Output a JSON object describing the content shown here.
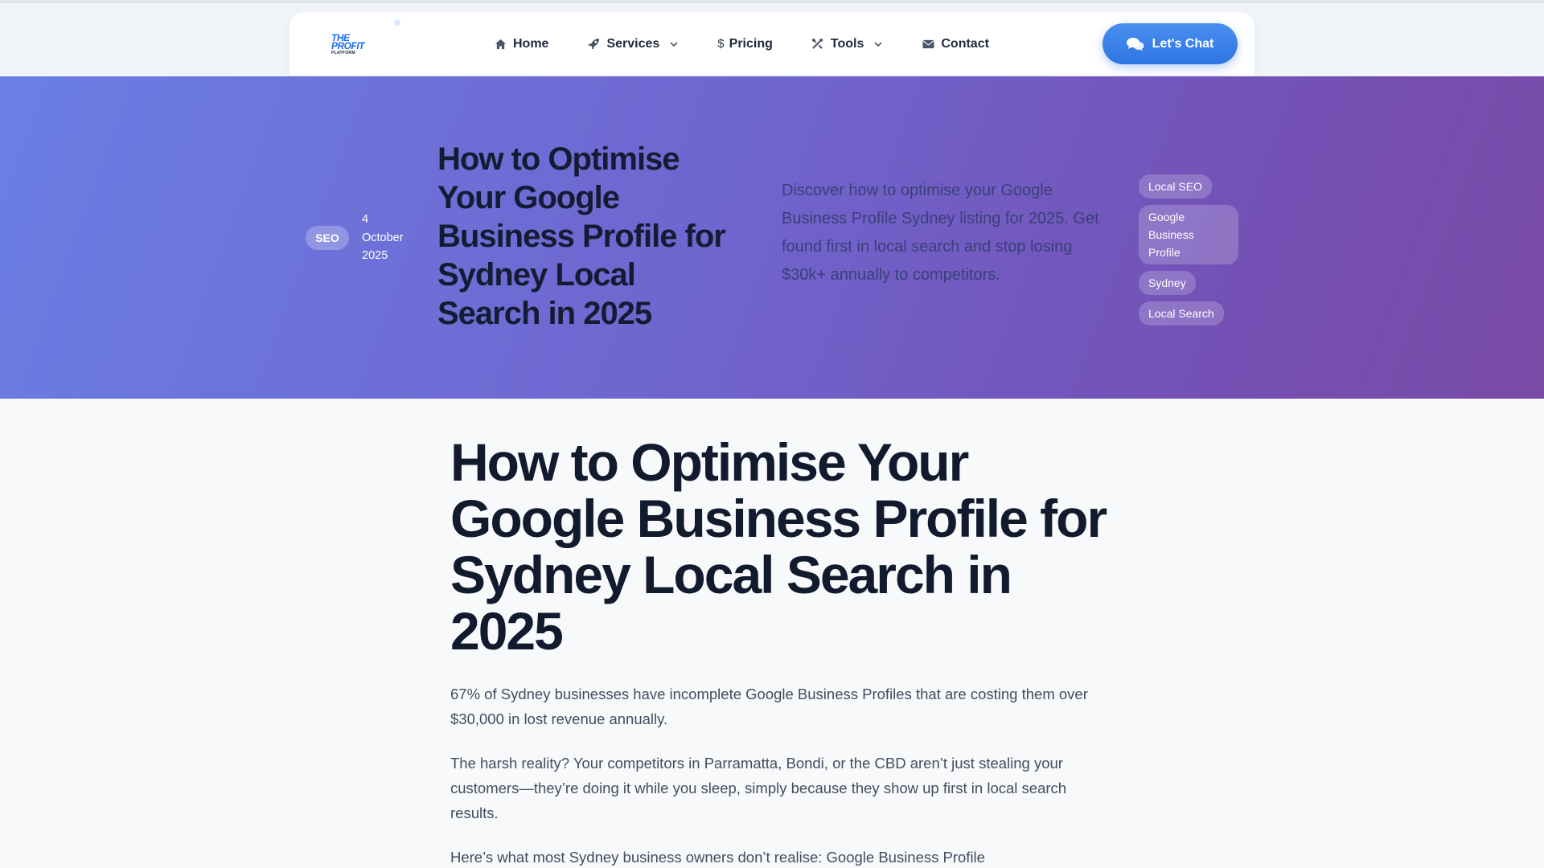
{
  "nav": {
    "logo": {
      "line1": "THE",
      "line2": "PROFIT",
      "line3": "PLATFORM"
    },
    "items": [
      {
        "label": "Home",
        "icon": "home-icon"
      },
      {
        "label": "Services",
        "icon": "rocket-icon",
        "dropdown": true
      },
      {
        "label": "Pricing",
        "icon": "dollar-icon"
      },
      {
        "label": "Tools",
        "icon": "tools-icon",
        "dropdown": true
      },
      {
        "label": "Contact",
        "icon": "envelope-icon"
      }
    ],
    "cta": {
      "label": "Let's Chat",
      "icon": "chat-icon"
    }
  },
  "hero": {
    "category": "SEO",
    "date_day": "4",
    "date_month": "October",
    "date_year": "2025",
    "title": "How to Optimise Your Google Business Profile for Sydney Local Search in 2025",
    "description": "Discover how to optimise your Google Business Profile Sydney listing for 2025. Get found first in local search and stop losing $30k+ annually to competitors.",
    "tags": [
      "Local SEO",
      "Google Business Profile",
      "Sydney",
      "Local Search"
    ]
  },
  "article": {
    "title": "How to Optimise Your Google Business Profile for Sydney Local Search in 2025",
    "paragraphs": [
      "67% of Sydney businesses have incomplete Google Business Profiles that are costing them over $30,000 in lost revenue annually.",
      "The harsh reality? Your competitors in Parramatta, Bondi, or the CBD aren’t just stealing your customers—they’re doing it while you sleep, simply because they show up first in local search results.",
      "Here’s what most Sydney business owners don’t realise: Google Business Profile"
    ]
  },
  "colors": {
    "brand_blue": "#2f75e2",
    "hero_start": "#6a7fe4",
    "hero_end": "#7a4aa6",
    "heading": "#121a2e"
  }
}
